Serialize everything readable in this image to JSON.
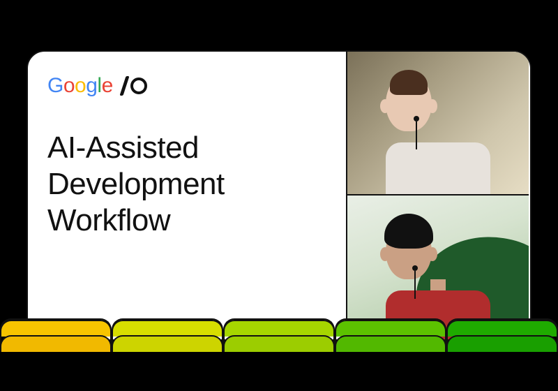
{
  "logo": {
    "word": "Google",
    "event": "I/O"
  },
  "title_lines": [
    "AI-Assisted",
    "Development",
    "Workflow"
  ],
  "title": "AI-Assisted Development Workflow"
}
